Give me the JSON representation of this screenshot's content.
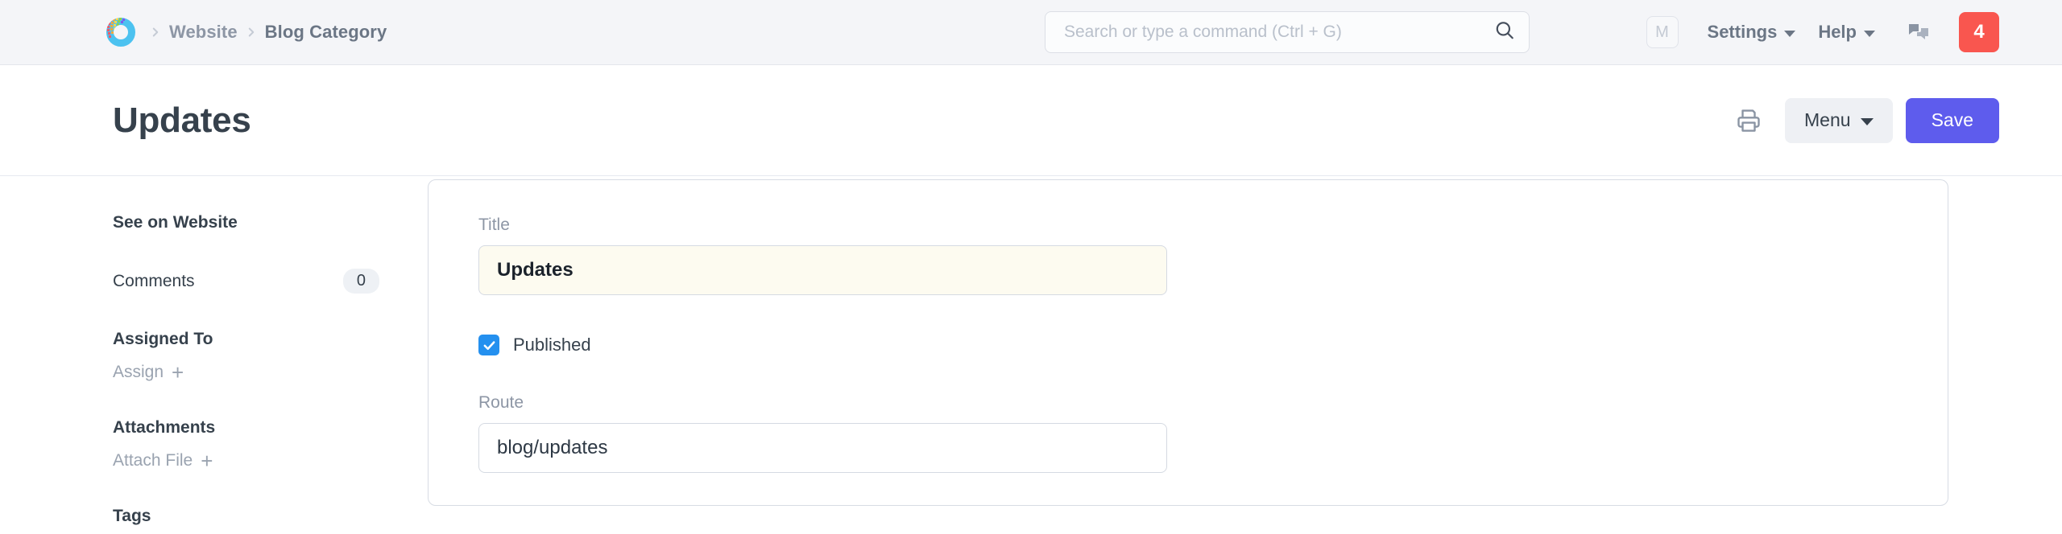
{
  "navbar": {
    "logo_name": "frappe-logo",
    "breadcrumb": [
      {
        "label": "Website",
        "current": false
      },
      {
        "label": "Blog Category",
        "current": true
      }
    ],
    "search": {
      "placeholder": "Search or type a command (Ctrl + G)",
      "value": "",
      "icon": "search-icon"
    },
    "avatar_initial": "M",
    "settings_label": "Settings",
    "help_label": "Help",
    "chat_icon": "chat-bubbles-icon",
    "notification_count": "4",
    "notification_color": "#f9564f"
  },
  "page_head": {
    "title": "Updates",
    "print_icon": "printer-icon",
    "menu_label": "Menu",
    "save_label": "Save",
    "save_color": "#5e5ced"
  },
  "sidebar": {
    "see_on_website": "See on Website",
    "comments_label": "Comments",
    "comments_count": "0",
    "assigned_to_label": "Assigned To",
    "assign_action": "Assign",
    "attachments_label": "Attachments",
    "attach_file_action": "Attach File",
    "tags_label": "Tags"
  },
  "form": {
    "title_field": {
      "label": "Title",
      "value": "Updates",
      "unsaved": true
    },
    "published_field": {
      "label": "Published",
      "checked": true,
      "accent": "#2490ef"
    },
    "route_field": {
      "label": "Route",
      "value": "blog/updates",
      "unsaved": false
    }
  }
}
